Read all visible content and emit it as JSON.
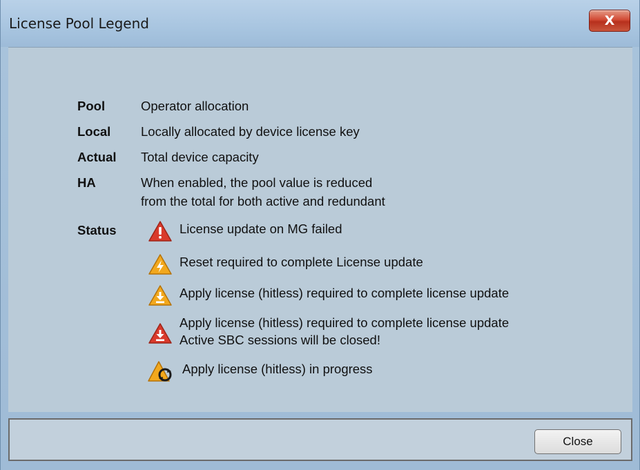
{
  "window": {
    "title": "License Pool Legend",
    "close_glyph": "X"
  },
  "legend": [
    {
      "label": "Pool",
      "description": "Operator allocation"
    },
    {
      "label": "Local",
      "description": "Locally allocated by device license key"
    },
    {
      "label": "Actual",
      "description": "Total device capacity"
    },
    {
      "label": "HA",
      "description_line1": "When enabled, the pool value is reduced",
      "description_line2": "from the total for both active and redundant"
    }
  ],
  "status": {
    "label": "Status",
    "items": [
      {
        "icon": "error-triangle-icon",
        "text": "License update on MG failed"
      },
      {
        "icon": "reset-required-icon",
        "text": "Reset required to complete License update"
      },
      {
        "icon": "apply-required-icon",
        "text": "Apply license (hitless) required to complete license update"
      },
      {
        "icon": "apply-required-critical-icon",
        "text_line1": "Apply license (hitless) required to complete license update",
        "text_line2": "Active SBC sessions will be closed!"
      },
      {
        "icon": "apply-in-progress-icon",
        "text": "Apply license (hitless) in progress"
      }
    ]
  },
  "footer": {
    "close_label": "Close"
  },
  "colors": {
    "red": "#d93a2b",
    "orange": "#f2a81d"
  }
}
